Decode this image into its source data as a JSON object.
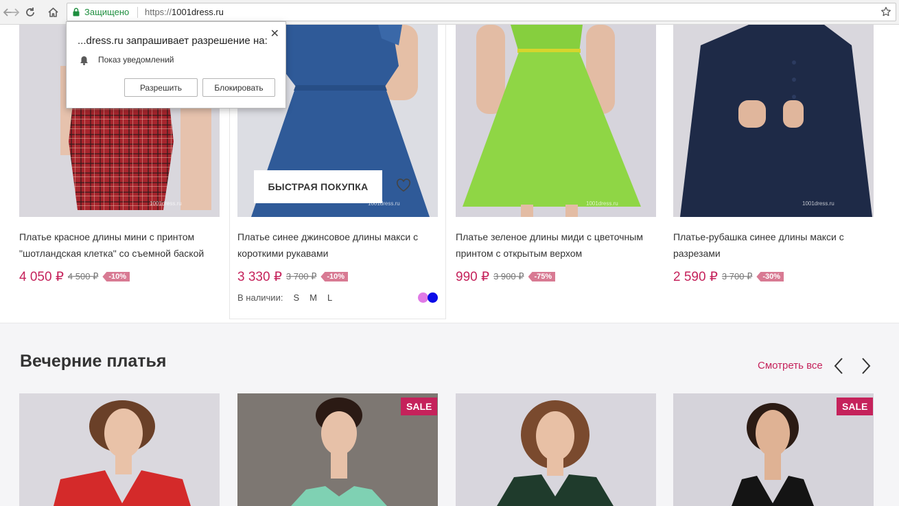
{
  "browser": {
    "secure_label": "Защищено",
    "url_scheme": "https://",
    "url_host": "1001dress.ru"
  },
  "notification": {
    "title": "...dress.ru запрашивает разрешение на:",
    "permission": "Показ уведомлений",
    "allow_label": "Разрешить",
    "block_label": "Блокировать",
    "close_glyph": "✕"
  },
  "products": [
    {
      "title_line1": "Платье красное длины мини с принтом",
      "title_line2": "\"шотландская клетка\" со съемной баской",
      "price": "4 050 ₽",
      "old_price": "4 500 ₽",
      "discount": "-10%"
    },
    {
      "title_line1": "Платье синее джинсовое длины макси с",
      "title_line2": "короткими рукавами",
      "price": "3 330 ₽",
      "old_price": "3 700 ₽",
      "discount": "-10%",
      "quick_buy_label": "БЫСТРАЯ ПОКУПКА",
      "stock_label": "В наличии:",
      "sizes": [
        "S",
        "M",
        "L"
      ],
      "swatch_colors": [
        "#e07ae6",
        "#0b0be8"
      ]
    },
    {
      "title_line1": "Платье зеленое длины миди с цветочным",
      "title_line2": "принтом с открытым верхом",
      "price": "990 ₽",
      "old_price": "3 900 ₽",
      "discount": "-75%"
    },
    {
      "title_line1": "Платье-рубашка синее длины макси с",
      "title_line2": "разрезами",
      "price": "2 590 ₽",
      "old_price": "3 700 ₽",
      "discount": "-30%"
    }
  ],
  "evening": {
    "title": "Вечерние платья",
    "see_all": "Смотреть все",
    "sale_badge_1": "SALE",
    "sale_badge_2": "SALE"
  },
  "colors": {
    "accent": "#c5225b",
    "discount_badge": "#d87a93",
    "secure_green": "#1e8e3e"
  }
}
